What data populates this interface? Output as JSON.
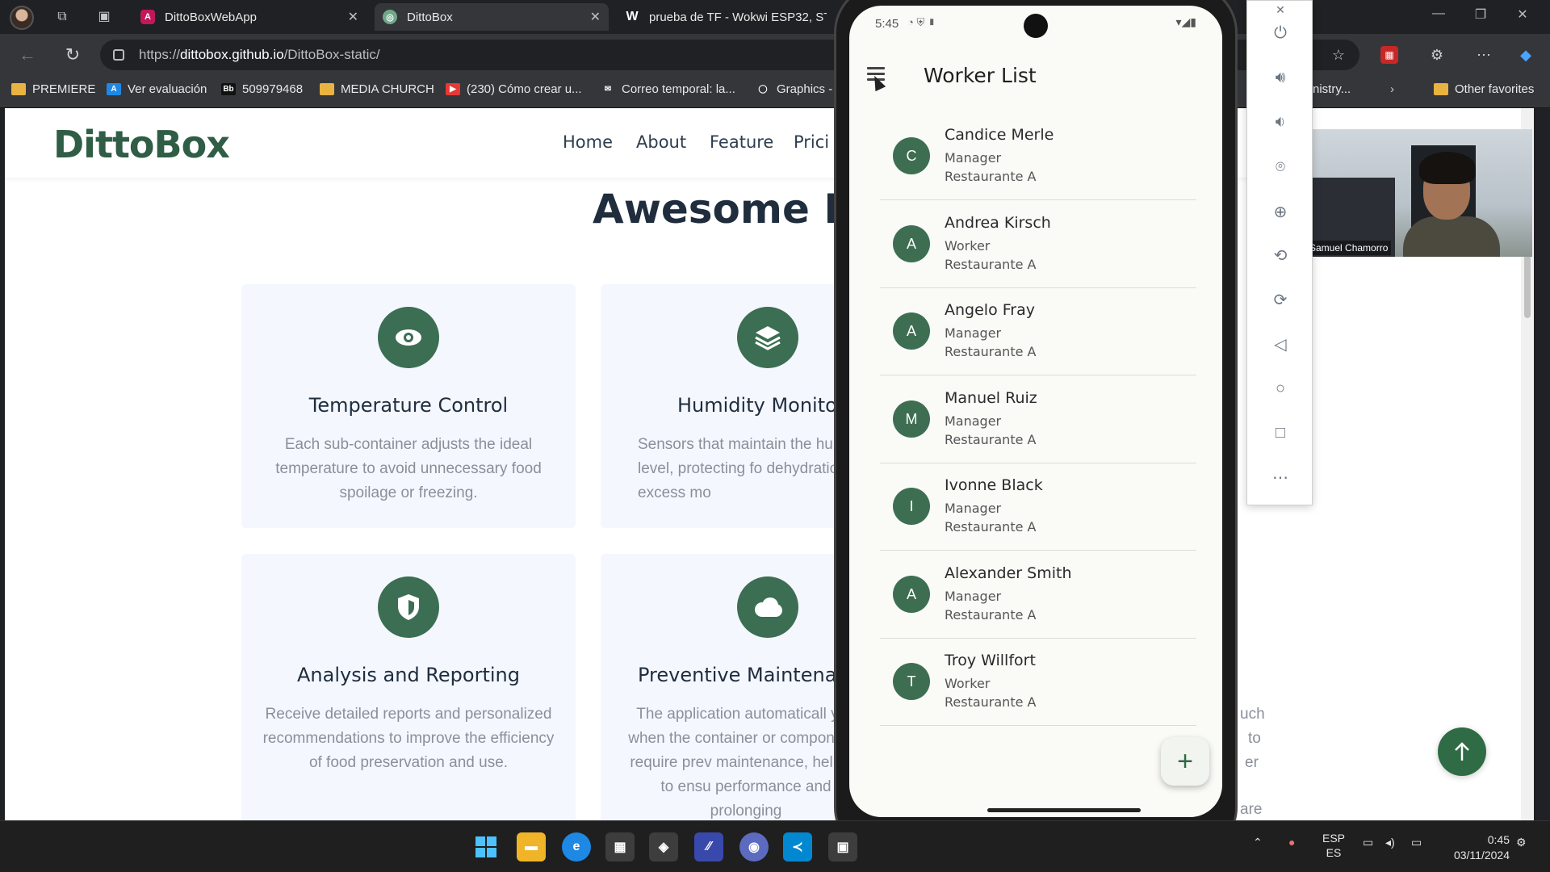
{
  "browser": {
    "tabs": [
      {
        "title": "DittoBoxWebApp",
        "active": false
      },
      {
        "title": "DittoBox",
        "active": true
      },
      {
        "title": "prueba de TF - Wokwi ESP32, STM",
        "active": false
      }
    ],
    "url_prefix": "https://",
    "url_host": "dittobox.github.io",
    "url_path": "/DittoBox-static/",
    "bookmarks": [
      {
        "label": "PREMIERE",
        "icon": "folder-icon"
      },
      {
        "label": "Ver evaluación",
        "icon": "a-logo-icon"
      },
      {
        "label": "509979468",
        "icon": "bb-logo-icon"
      },
      {
        "label": "MEDIA CHURCH",
        "icon": "folder-icon"
      },
      {
        "label": "(230) Cómo crear u...",
        "icon": "youtube-icon"
      },
      {
        "label": "Correo temporal: la...",
        "icon": "mail-icon"
      },
      {
        "label": "Graphics -",
        "icon": "circle-icon"
      },
      {
        "label": "nistry...",
        "icon": "none"
      },
      {
        "label": "Other favorites",
        "icon": "folder-icon"
      }
    ]
  },
  "site": {
    "logo": "DittoBox",
    "nav": [
      "Home",
      "About",
      "Feature",
      "Prici"
    ],
    "section_title": "Awesome Fea",
    "cards": [
      {
        "title": "Temperature Control",
        "icon": "eye-icon",
        "desc": "Each sub-container adjusts the ideal temperature to avoid unnecessary food spoilage or freezing."
      },
      {
        "title": "Humidity Monitor",
        "icon": "layers-icon",
        "desc": "Sensors that maintain the humidity level, protecting fo dehydration or excess mo"
      },
      {
        "title": "Analysis and Reporting",
        "icon": "shield-icon",
        "desc": "Receive detailed reports and personalized recommendations to improve the efficiency of food preservation and use."
      },
      {
        "title": "Preventive Maintenanc",
        "icon": "cloud-icon",
        "desc": "The application automaticall you when the container or components require prev maintenance, helping to ensu performance and prolonging"
      }
    ],
    "right_edge_fragments": [
      "uch",
      "to",
      "er",
      "are"
    ],
    "accent_color": "#3b6e52"
  },
  "webcam": {
    "name": "Samuel Chamorro"
  },
  "phone": {
    "status_time": "5:45",
    "app_title": "Worker List",
    "workers": [
      {
        "initial": "C",
        "name": "Candice Merle",
        "role": "Manager",
        "restaurant": "Restaurante A"
      },
      {
        "initial": "A",
        "name": "Andrea Kirsch",
        "role": "Worker",
        "restaurant": "Restaurante A"
      },
      {
        "initial": "A",
        "name": "Angelo Fray",
        "role": "Manager",
        "restaurant": "Restaurante A"
      },
      {
        "initial": "M",
        "name": "Manuel Ruiz",
        "role": "Manager",
        "restaurant": "Restaurante A"
      },
      {
        "initial": "I",
        "name": "Ivonne Black",
        "role": "Manager",
        "restaurant": "Restaurante A"
      },
      {
        "initial": "A",
        "name": "Alexander Smith",
        "role": "Manager",
        "restaurant": "Restaurante A"
      },
      {
        "initial": "T",
        "name": "Troy Willfort",
        "role": "Worker",
        "restaurant": "Restaurante A"
      }
    ],
    "fab_label": "+"
  },
  "taskbar": {
    "lang_top": "ESP",
    "lang_bottom": "ES",
    "time": "0:45",
    "date": "03/11/2024"
  }
}
